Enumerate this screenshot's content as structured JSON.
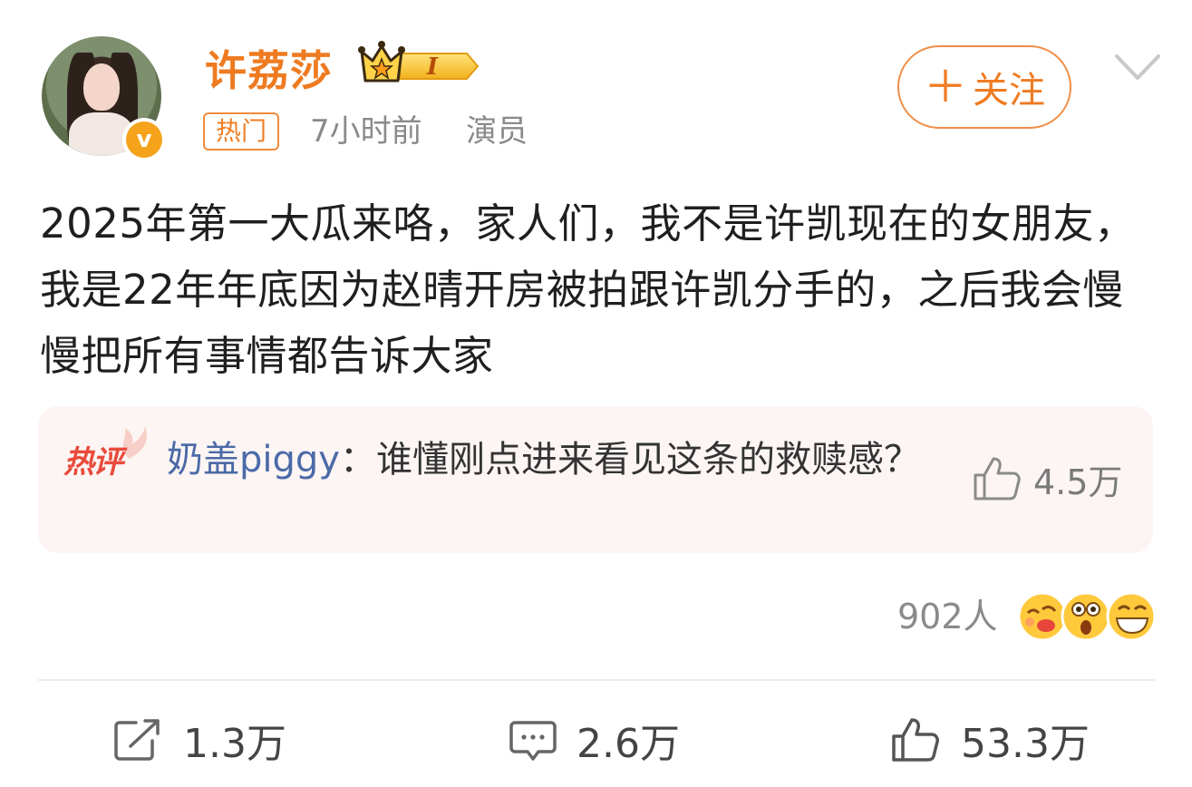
{
  "header": {
    "username": "许荔莎",
    "vip_level": "I",
    "tag": "热门",
    "time": "7小时前",
    "role": "演员",
    "follow_label": "关注",
    "verified_mark": "v"
  },
  "post": {
    "text": "2025年第一大瓜来咯，家人们，我不是许凯现在的女朋友，我是22年年底因为赵晴开房被拍跟许凯分手的，之后我会慢慢把所有事情都告诉大家"
  },
  "hot_comment": {
    "label": "热评",
    "user": "奶盖piggy",
    "separator": "：",
    "text": "谁懂刚点进来看见这条的救赎感？",
    "likes": "4.5万"
  },
  "reactions": {
    "count": "902人",
    "emojis": [
      "kiss-face-icon",
      "surprised-face-icon",
      "grinning-face-icon"
    ]
  },
  "actions": {
    "share": "1.3万",
    "comment": "2.6万",
    "like": "53.3万"
  },
  "colors": {
    "username": "#ee7b21",
    "accent_orange": "#ef7b22",
    "comment_user": "#4b6aa7",
    "hot_comment_bg": "#fdf5f4"
  }
}
